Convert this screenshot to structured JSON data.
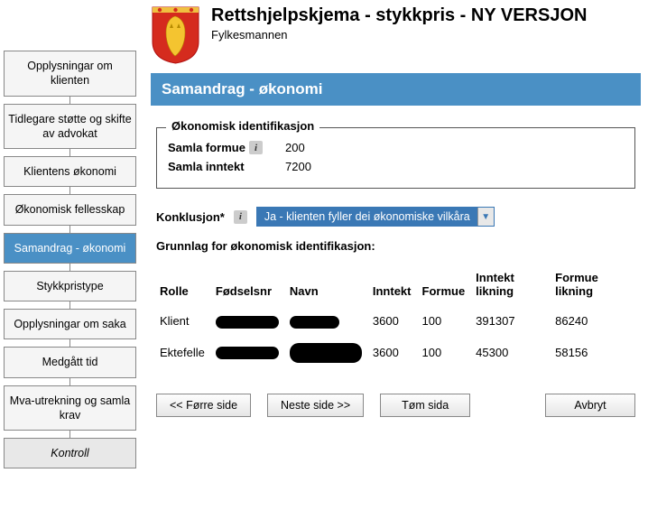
{
  "header": {
    "title": "Rettshjelpskjema - stykkpris - NY VERSJON",
    "subtitle": "Fylkesmannen"
  },
  "nav": {
    "items": [
      "Opplysningar om klienten",
      "Tidlegare støtte og skifte av advokat",
      "Klientens økonomi",
      "Økonomisk fellesskap",
      "Samandrag - økonomi",
      "Stykkpristype",
      "Opplysningar om saka",
      "Medgått tid",
      "Mva-utrekning og samla krav",
      "Kontroll"
    ],
    "active_index": 4
  },
  "section_title": "Samandrag - økonomi",
  "ident": {
    "legend": "Økonomisk identifikasjon",
    "formue_label": "Samla formue",
    "formue_value": "200",
    "inntekt_label": "Samla inntekt",
    "inntekt_value": "7200"
  },
  "konklusjon": {
    "label": "Konklusjon*",
    "selected": "Ja - klienten fyller dei økonomiske vilkåra"
  },
  "grunnlag_label": "Grunnlag for økonomisk identifikasjon:",
  "table": {
    "headers": {
      "rolle": "Rolle",
      "fodselsnr": "Fødselsnr",
      "navn": "Navn",
      "inntekt": "Inntekt",
      "formue": "Formue",
      "inntekt_likning": "Inntekt likning",
      "formue_likning": "Formue likning"
    },
    "rows": [
      {
        "rolle": "Klient",
        "inntekt": "3600",
        "formue": "100",
        "inntekt_likning": "391307",
        "formue_likning": "86240"
      },
      {
        "rolle": "Ektefelle",
        "inntekt": "3600",
        "formue": "100",
        "inntekt_likning": "45300",
        "formue_likning": "58156"
      }
    ]
  },
  "buttons": {
    "prev": "<< Førre side",
    "next": "Neste side >>",
    "clear": "Tøm sida",
    "cancel": "Avbryt"
  }
}
